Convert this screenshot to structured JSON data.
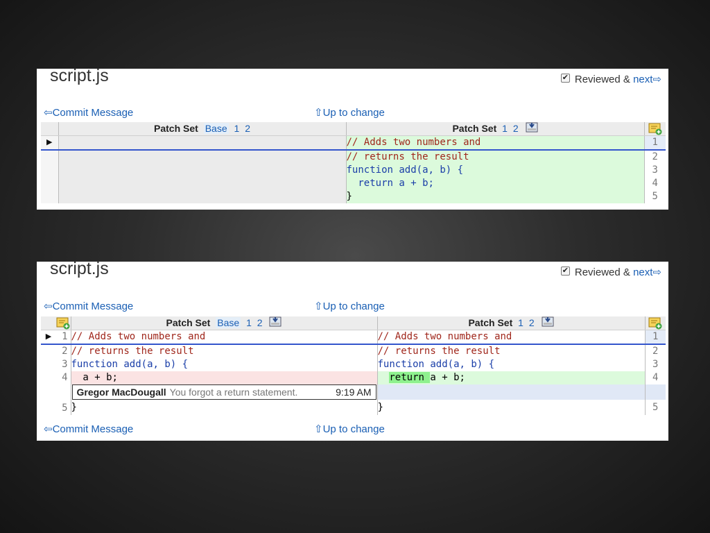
{
  "panel1": {
    "filename": "script.js",
    "reviewed_label": "Reviewed & ",
    "next_label": "next⇨",
    "commit_link": "⇦Commit Message",
    "up_link": "⇧Up to change",
    "left_header": {
      "label": "Patch Set",
      "sets": [
        "Base",
        "1",
        "2"
      ]
    },
    "right_header": {
      "label": "Patch Set",
      "sets": [
        "1",
        "2"
      ]
    },
    "lines": [
      {
        "n": "1",
        "code": "// Adds two numbers and"
      },
      {
        "n": "2",
        "code": "// returns the result"
      },
      {
        "n": "3",
        "code": "function add(a, b) {"
      },
      {
        "n": "4",
        "code": "  return a + b;"
      },
      {
        "n": "5",
        "code": "}"
      }
    ]
  },
  "panel2": {
    "filename": "script.js",
    "reviewed_label": "Reviewed & ",
    "next_label": "next⇨",
    "commit_link": "⇦Commit Message",
    "up_link": "⇧Up to change",
    "commit_link_bottom": "⇦Commit Message",
    "up_link_bottom": "⇧Up to change",
    "left_header": {
      "label": "Patch Set",
      "sets": [
        "Base",
        "1",
        "2"
      ]
    },
    "right_header": {
      "label": "Patch Set",
      "sets": [
        "1",
        "2"
      ]
    },
    "left_lines": [
      {
        "n": "1",
        "code": "// Adds two numbers and"
      },
      {
        "n": "2",
        "code": "// returns the result"
      },
      {
        "n": "3",
        "code": "function add(a, b) {"
      },
      {
        "n": "4",
        "code": "  a + b;"
      },
      {
        "n": "5",
        "code": "}"
      }
    ],
    "right_lines": [
      {
        "n": "1",
        "code": "// Adds two numbers and"
      },
      {
        "n": "2",
        "code": "// returns the result"
      },
      {
        "n": "3",
        "code": "function add(a, b) {"
      },
      {
        "n": "4",
        "code": "  return a + b;"
      },
      {
        "n": "5",
        "code": "}"
      }
    ],
    "comment": {
      "author": "Gregor MacDougall",
      "message": "You forgot a return statement.",
      "time": "9:19 AM"
    }
  }
}
